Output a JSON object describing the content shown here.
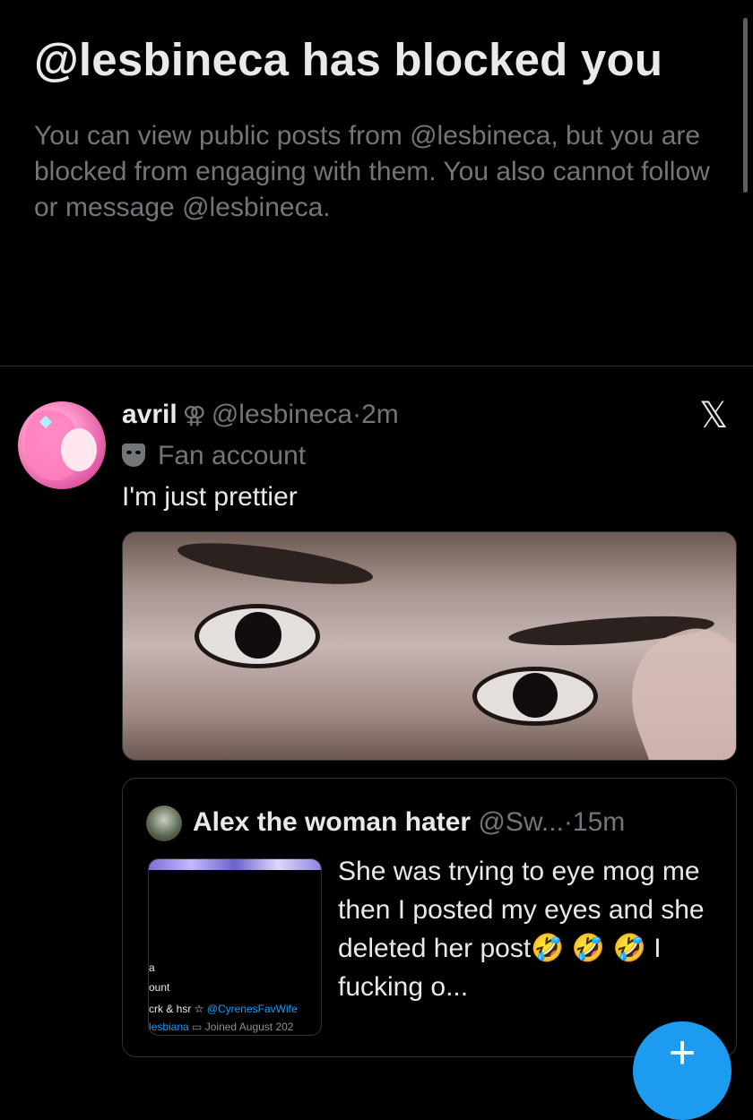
{
  "blocked_notice": {
    "title": "@lesbineca has blocked you",
    "description": "You can view public posts from @lesbineca, but you are blocked from engaging with them. You also cannot follow or message @lesbineca."
  },
  "tweet": {
    "display_name": "avril",
    "gender_symbol": "⚢",
    "handle": "@lesbineca",
    "separator": "·",
    "time": "2m",
    "label": "Fan account",
    "text": "I'm just prettier",
    "logo": "𝕏"
  },
  "quoted_tweet": {
    "display_name": "Alex the woman hater",
    "handle": "@Sw...",
    "separator": "·",
    "time": "15m",
    "text": "She was trying to eye mog me then I posted my eyes and she deleted her post🤣 🤣 🤣 I fucking o...",
    "thumbnail": {
      "line_a": "a",
      "line_ount": "ount",
      "line_crk": "crk & hsr ☆",
      "line_crk_link": "@CyrenesFavWife",
      "line_esbiana": "lesbiana",
      "line_joined": "Joined August 202"
    }
  },
  "fab": {
    "label": "+"
  },
  "colors": {
    "accent": "#1d9bf0",
    "muted": "#71767b",
    "background": "#000000"
  }
}
